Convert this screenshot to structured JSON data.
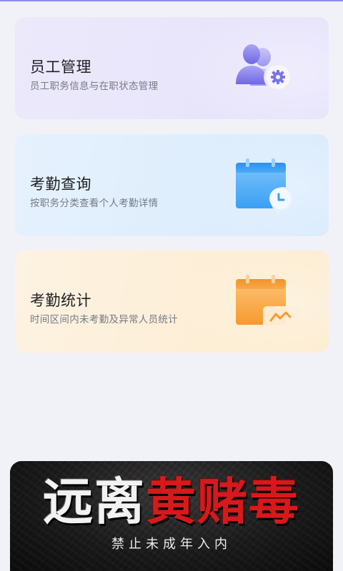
{
  "cards": [
    {
      "title": "员工管理",
      "desc": "员工职务信息与在职状态管理",
      "icon": "staff-settings-icon",
      "accent": "#7d77ea"
    },
    {
      "title": "考勤查询",
      "desc": "按职务分类查看个人考勤详情",
      "icon": "calendar-clock-icon",
      "accent": "#3aa0f5"
    },
    {
      "title": "考勤统计",
      "desc": "时间区间内未考勤及异常人员统计",
      "icon": "calendar-chart-icon",
      "accent": "#f7a33a"
    }
  ],
  "banner": {
    "headline_white": "远离",
    "headline_red": "黄赌毒",
    "subtitle": "禁止未成年入内"
  }
}
